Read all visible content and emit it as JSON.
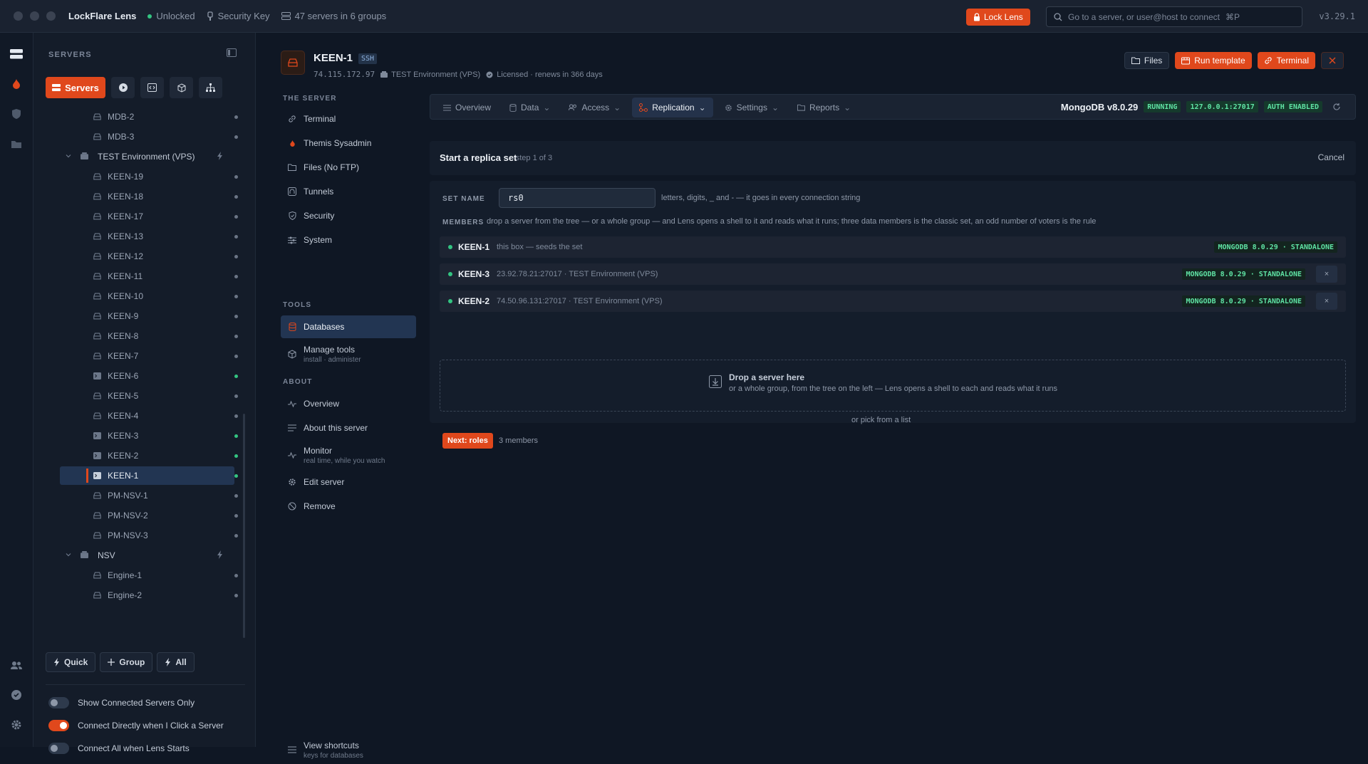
{
  "titlebar": {
    "app": "LockFlare Lens",
    "status": "Unlocked",
    "security_key": "Security Key",
    "servers": "47 servers in 6 groups",
    "lock_label": "Lock Lens",
    "search_placeholder": "Go to a server, or user@host to connect",
    "search_shortcut": "⌘P",
    "version": "v3.29.1"
  },
  "sidebar": {
    "heading": "SERVERS",
    "tab_servers": "Servers",
    "tree": [
      {
        "kind": "server",
        "label": "MDB-2",
        "online": false,
        "icon": "server"
      },
      {
        "kind": "server",
        "label": "MDB-3",
        "online": false,
        "icon": "server"
      },
      {
        "kind": "group",
        "label": "TEST Environment (VPS)"
      },
      {
        "kind": "server",
        "label": "KEEN-19",
        "online": false,
        "icon": "server"
      },
      {
        "kind": "server",
        "label": "KEEN-18",
        "online": false,
        "icon": "server"
      },
      {
        "kind": "server",
        "label": "KEEN-17",
        "online": false,
        "icon": "server"
      },
      {
        "kind": "server",
        "label": "KEEN-13",
        "online": false,
        "icon": "server"
      },
      {
        "kind": "server",
        "label": "KEEN-12",
        "online": false,
        "icon": "server"
      },
      {
        "kind": "server",
        "label": "KEEN-11",
        "online": false,
        "icon": "server"
      },
      {
        "kind": "server",
        "label": "KEEN-10",
        "online": false,
        "icon": "server"
      },
      {
        "kind": "server",
        "label": "KEEN-9",
        "online": false,
        "icon": "server"
      },
      {
        "kind": "server",
        "label": "KEEN-8",
        "online": false,
        "icon": "server"
      },
      {
        "kind": "server",
        "label": "KEEN-7",
        "online": false,
        "icon": "server"
      },
      {
        "kind": "server",
        "label": "KEEN-6",
        "online": true,
        "icon": "terminal"
      },
      {
        "kind": "server",
        "label": "KEEN-5",
        "online": false,
        "icon": "server"
      },
      {
        "kind": "server",
        "label": "KEEN-4",
        "online": false,
        "icon": "server"
      },
      {
        "kind": "server",
        "label": "KEEN-3",
        "online": true,
        "icon": "terminal"
      },
      {
        "kind": "server",
        "label": "KEEN-2",
        "online": true,
        "icon": "terminal"
      },
      {
        "kind": "server",
        "label": "KEEN-1",
        "online": true,
        "icon": "terminal",
        "selected": true
      },
      {
        "kind": "server",
        "label": "PM-NSV-1",
        "online": false,
        "icon": "server"
      },
      {
        "kind": "server",
        "label": "PM-NSV-2",
        "online": false,
        "icon": "server"
      },
      {
        "kind": "server",
        "label": "PM-NSV-3",
        "online": false,
        "icon": "server"
      },
      {
        "kind": "group",
        "label": "NSV"
      },
      {
        "kind": "server",
        "label": "Engine-1",
        "online": false,
        "icon": "server"
      },
      {
        "kind": "server",
        "label": "Engine-2",
        "online": false,
        "icon": "server"
      }
    ],
    "actions": {
      "quick": "Quick",
      "group": "Group",
      "all": "All"
    },
    "toggles": [
      {
        "label": "Show Connected Servers Only",
        "on": false
      },
      {
        "label": "Connect Directly when I Click a Server",
        "on": true
      },
      {
        "label": "Connect All when Lens Starts",
        "on": false
      }
    ]
  },
  "server": {
    "name": "KEEN-1",
    "badge": "SSH",
    "ip": "74.115.172.97",
    "group": "TEST Environment (VPS)",
    "license": "Licensed · renews in 366 days"
  },
  "header_buttons": {
    "files": "Files",
    "run_template": "Run template",
    "terminal": "Terminal"
  },
  "nav": {
    "the_server": "THE SERVER",
    "tools": "TOOLS",
    "about": "ABOUT",
    "terminal": "Terminal",
    "themis": "Themis Sysadmin",
    "files": "Files (No FTP)",
    "tunnels": "Tunnels",
    "security": "Security",
    "system": "System",
    "databases": "Databases",
    "manage_tools": "Manage tools",
    "manage_tools_sub": "install · administer",
    "overview": "Overview",
    "about_server": "About this server",
    "monitor": "Monitor",
    "monitor_sub": "real time, while you watch",
    "edit_server": "Edit server",
    "remove": "Remove",
    "shortcuts": "View shortcuts",
    "shortcuts_sub": "keys for databases"
  },
  "tabs": {
    "overview": "Overview",
    "data": "Data",
    "access": "Access",
    "replication": "Replication",
    "settings": "Settings",
    "reports": "Reports"
  },
  "db": {
    "name": "MongoDB v8.0.29",
    "status": "RUNNING",
    "addr": "127.0.0.1:27017",
    "auth": "AUTH ENABLED"
  },
  "wizard": {
    "title": "Start a replica set",
    "step": "· step 1 of 3",
    "cancel": "Cancel",
    "set_name_label": "SET NAME",
    "set_name_value": "rs0",
    "set_name_help": "letters, digits, _ and - — it goes in every connection string",
    "members_label": "MEMBERS",
    "members_help": "drop a server from the tree — or a whole group — and Lens opens a shell to it and reads what it runs; three data members is the classic set, an odd number of voters is the rule",
    "members": [
      {
        "name": "KEEN-1",
        "meta": "this box — seeds the set",
        "badge": "MONGODB 8.0.29 · STANDALONE",
        "removable": false
      },
      {
        "name": "KEEN-3",
        "meta": "23.92.78.21:27017 · TEST Environment (VPS)",
        "badge": "MONGODB 8.0.29 · STANDALONE",
        "removable": true
      },
      {
        "name": "KEEN-2",
        "meta": "74.50.96.131:27017 · TEST Environment (VPS)",
        "badge": "MONGODB 8.0.29 · STANDALONE",
        "removable": true
      }
    ],
    "remove_label": "×",
    "drop_title": "Drop a server here",
    "drop_sub": "or a whole group, from the tree on the left — Lens opens a shell to each and reads what it runs",
    "pick": "or pick from a list",
    "next": "Next: roles",
    "count": "3 members"
  },
  "colors": {
    "accent": "#e0481c",
    "online": "#33c481",
    "selected": "#223552"
  }
}
